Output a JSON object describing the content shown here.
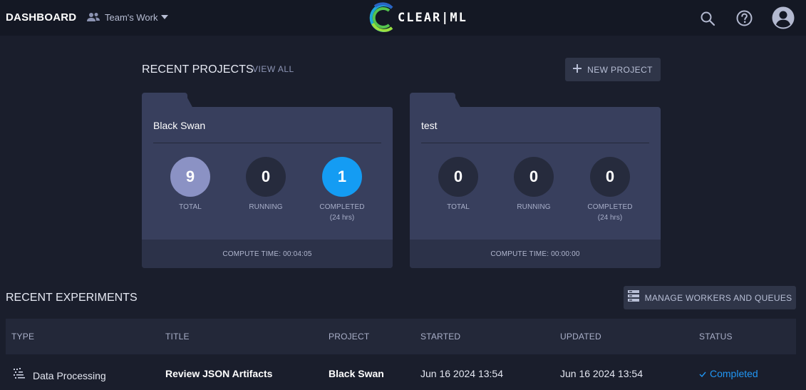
{
  "header": {
    "title": "DASHBOARD",
    "workspace": "Team's Work",
    "logo_text": "CLEAR|ML",
    "icons": [
      "search-icon",
      "help-icon",
      "user-avatar-icon"
    ]
  },
  "projects_section": {
    "title": "RECENT PROJECTS",
    "view_all": "VIEW ALL",
    "new_project": "NEW PROJECT",
    "projects": [
      {
        "name": "Black Swan",
        "total": "9",
        "running": "0",
        "completed": "1",
        "total_label": "TOTAL",
        "running_label": "RUNNING",
        "completed_label": "COMPLETED",
        "completed_sub": "(24 hrs)",
        "compute_time": "COMPUTE TIME: 00:04:05"
      },
      {
        "name": "test",
        "total": "0",
        "running": "0",
        "completed": "0",
        "total_label": "TOTAL",
        "running_label": "RUNNING",
        "completed_label": "COMPLETED",
        "completed_sub": "(24 hrs)",
        "compute_time": "COMPUTE TIME: 00:00:00"
      }
    ]
  },
  "experiments_section": {
    "title": "RECENT EXPERIMENTS",
    "manage": "MANAGE WORKERS AND QUEUES",
    "columns": [
      "TYPE",
      "TITLE",
      "PROJECT",
      "STARTED",
      "UPDATED",
      "STATUS"
    ],
    "rows": [
      {
        "type": "Data Processing",
        "title": "Review JSON Artifacts",
        "project": "Black Swan",
        "started": "Jun 16 2024 13:54",
        "updated": "Jun 16 2024 13:54",
        "status": "Completed"
      }
    ]
  },
  "colors": {
    "background": "#1a1e2c",
    "topbar": "#141824",
    "card": "#383f5d",
    "accent_blue": "#149cf3",
    "total_active": "#8b92c4"
  }
}
